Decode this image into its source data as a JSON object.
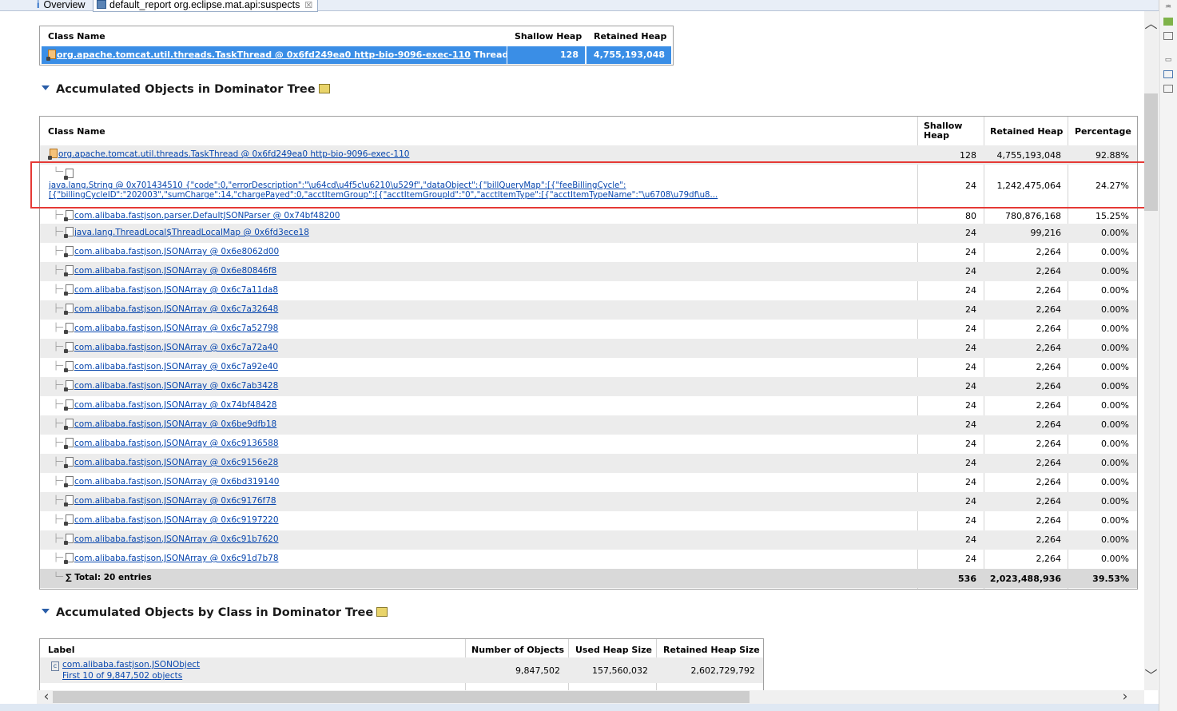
{
  "tabs": {
    "overview_label": "Overview",
    "overview_icon": "info-icon",
    "report_label": "default_report  org.eclipse.mat.api:suspects",
    "report_icon": "report-icon",
    "close_symbol": "☒"
  },
  "summary_table": {
    "headers": {
      "class_name": "Class Name",
      "shallow": "Shallow Heap",
      "retained": "Retained Heap"
    },
    "row": {
      "class_name": "org.apache.tomcat.util.threads.TaskThread @ 0x6fd249ea0 http-bio-9096-exec-110",
      "suffix": "Thread",
      "shallow": "128",
      "retained": "4,755,193,048"
    }
  },
  "section1": {
    "title": "Accumulated Objects in Dominator Tree"
  },
  "tree_table": {
    "headers": {
      "class_name": "Class Name",
      "shallow_1": "Shallow",
      "shallow_2": "Heap",
      "retained": "Retained Heap",
      "percentage": "Percentage"
    },
    "root": {
      "name": "org.apache.tomcat.util.threads.TaskThread @ 0x6fd249ea0 http-bio-9096-exec-110",
      "shallow": "128",
      "retained": "4,755,193,048",
      "pct": "92.88%"
    },
    "string_row": {
      "line1": "java.lang.String @ 0x701434510 {\"code\":0,\"errorDescription\":\"\\u64cd\\u4f5c\\u6210\\u529f\",\"dataObject\":{\"billQueryMap\":[{\"feeBillingCycle\":",
      "line2": "[{\"billingCycleID\":\"202003\",\"sumCharge\":14,\"chargePayed\":0,\"acctItemGroup\":[{\"acctItemGroupId\":\"0\",\"acctItemType\":[{\"acctItemTypeName\":\"\\u6708\\u79df\\u8...",
      "shallow": "24",
      "retained": "1,242,475,064",
      "pct": "24.27%"
    },
    "rows": [
      {
        "name": "com.alibaba.fastjson.parser.DefaultJSONParser @ 0x74bf48200",
        "shallow": "80",
        "retained": "780,876,168",
        "pct": "15.25%"
      },
      {
        "name": "java.lang.ThreadLocal$ThreadLocalMap @ 0x6fd3ece18",
        "shallow": "24",
        "retained": "99,216",
        "pct": "0.00%"
      },
      {
        "name": "com.alibaba.fastjson.JSONArray @ 0x6e8062d00",
        "shallow": "24",
        "retained": "2,264",
        "pct": "0.00%"
      },
      {
        "name": "com.alibaba.fastjson.JSONArray @ 0x6e80846f8",
        "shallow": "24",
        "retained": "2,264",
        "pct": "0.00%"
      },
      {
        "name": "com.alibaba.fastjson.JSONArray @ 0x6c7a11da8",
        "shallow": "24",
        "retained": "2,264",
        "pct": "0.00%"
      },
      {
        "name": "com.alibaba.fastjson.JSONArray @ 0x6c7a32648",
        "shallow": "24",
        "retained": "2,264",
        "pct": "0.00%"
      },
      {
        "name": "com.alibaba.fastjson.JSONArray @ 0x6c7a52798",
        "shallow": "24",
        "retained": "2,264",
        "pct": "0.00%"
      },
      {
        "name": "com.alibaba.fastjson.JSONArray @ 0x6c7a72a40",
        "shallow": "24",
        "retained": "2,264",
        "pct": "0.00%"
      },
      {
        "name": "com.alibaba.fastjson.JSONArray @ 0x6c7a92e40",
        "shallow": "24",
        "retained": "2,264",
        "pct": "0.00%"
      },
      {
        "name": "com.alibaba.fastjson.JSONArray @ 0x6c7ab3428",
        "shallow": "24",
        "retained": "2,264",
        "pct": "0.00%"
      },
      {
        "name": "com.alibaba.fastjson.JSONArray @ 0x74bf48428",
        "shallow": "24",
        "retained": "2,264",
        "pct": "0.00%"
      },
      {
        "name": "com.alibaba.fastjson.JSONArray @ 0x6be9dfb18",
        "shallow": "24",
        "retained": "2,264",
        "pct": "0.00%"
      },
      {
        "name": "com.alibaba.fastjson.JSONArray @ 0x6c9136588",
        "shallow": "24",
        "retained": "2,264",
        "pct": "0.00%"
      },
      {
        "name": "com.alibaba.fastjson.JSONArray @ 0x6c9156e28",
        "shallow": "24",
        "retained": "2,264",
        "pct": "0.00%"
      },
      {
        "name": "com.alibaba.fastjson.JSONArray @ 0x6bd319140",
        "shallow": "24",
        "retained": "2,264",
        "pct": "0.00%"
      },
      {
        "name": "com.alibaba.fastjson.JSONArray @ 0x6c9176f78",
        "shallow": "24",
        "retained": "2,264",
        "pct": "0.00%"
      },
      {
        "name": "com.alibaba.fastjson.JSONArray @ 0x6c9197220",
        "shallow": "24",
        "retained": "2,264",
        "pct": "0.00%"
      },
      {
        "name": "com.alibaba.fastjson.JSONArray @ 0x6c91b7620",
        "shallow": "24",
        "retained": "2,264",
        "pct": "0.00%"
      },
      {
        "name": "com.alibaba.fastjson.JSONArray @ 0x6c91d7b78",
        "shallow": "24",
        "retained": "2,264",
        "pct": "0.00%"
      }
    ],
    "total": {
      "label": "Total: 20 entries",
      "symbol": "∑",
      "shallow": "536",
      "retained": "2,023,488,936",
      "pct": "39.53%"
    }
  },
  "section2": {
    "title": "Accumulated Objects by Class in Dominator Tree"
  },
  "class_table": {
    "headers": {
      "label": "Label",
      "num": "Number of Objects",
      "used": "Used Heap Size",
      "retained": "Retained Heap Size"
    },
    "row": {
      "name": "com.alibaba.fastjson.JSONObject",
      "sub": "First 10 of 9,847,502 objects",
      "num": "9,847,502",
      "used": "157,560,032",
      "retained": "2,602,729,792"
    }
  }
}
